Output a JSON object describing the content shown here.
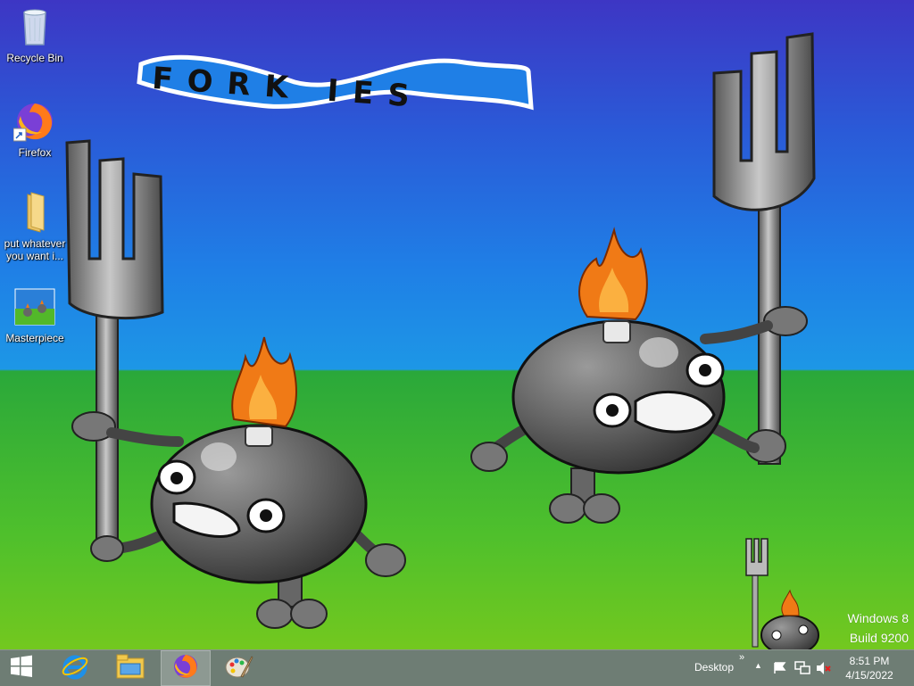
{
  "wallpaper": {
    "banner_text": "FORK IES"
  },
  "desktop_icons": [
    {
      "label": "Recycle Bin",
      "icon": "recycle-bin-icon"
    },
    {
      "label": "Firefox",
      "icon": "firefox-icon"
    },
    {
      "label": "put whatever you want i...",
      "icon": "folder-icon"
    },
    {
      "label": "Masterpiece",
      "icon": "image-file-icon"
    }
  ],
  "watermark": {
    "line1": "Windows 8",
    "line2": "Build 9200"
  },
  "taskbar": {
    "pinned": [
      {
        "name": "start",
        "icon": "windows-logo-icon"
      },
      {
        "name": "internet-explorer",
        "icon": "internet-explorer-icon"
      },
      {
        "name": "file-explorer",
        "icon": "file-explorer-icon"
      },
      {
        "name": "firefox",
        "icon": "firefox-icon",
        "active": true
      },
      {
        "name": "paint",
        "icon": "paint-icon"
      }
    ],
    "toolbar_label": "Desktop",
    "chevron": "»",
    "clock": {
      "time": "8:51 PM",
      "date": "4/15/2022"
    }
  },
  "colors": {
    "sky_top": "#3d36c4",
    "sky_bottom": "#1d97e6",
    "grass_top": "#2aa83a",
    "grass_bottom": "#73c81f",
    "taskbar": "#6e7d74"
  }
}
